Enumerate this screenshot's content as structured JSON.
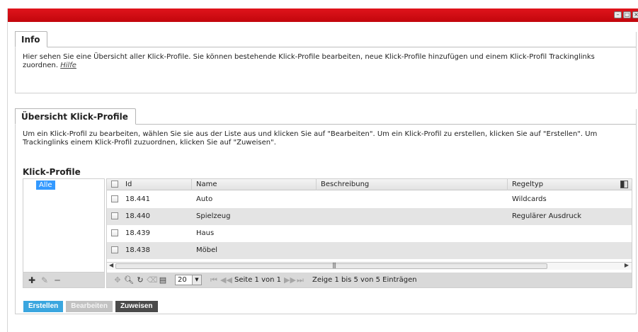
{
  "window": {
    "controls": [
      "–",
      "□",
      "×"
    ]
  },
  "info": {
    "tab": "Info",
    "text": "Hier sehen Sie eine Übersicht aller Klick-Profile. Sie können bestehende Klick-Profile bearbeiten, neue Klick-Profile hinzufügen und einem Klick-Profil Trackinglinks zuordnen.",
    "help_link": "Hilfe"
  },
  "overview": {
    "tab": "Übersicht Klick-Profile",
    "text": "Um ein Klick-Profil zu bearbeiten, wählen Sie sie aus der Liste aus und klicken Sie auf \"Bearbeiten\". Um ein Klick-Profil zu erstellen, klicken Sie auf \"Erstellen\". Um Trackinglinks einem Klick-Profil zuzuordnen, klicken Sie auf \"Zuweisen\".",
    "section_title": "Klick-Profile",
    "tree": {
      "selected": "Alle"
    },
    "grid": {
      "columns": [
        "Id",
        "Name",
        "Beschreibung",
        "Regeltyp"
      ],
      "rows": [
        {
          "id": "18.441",
          "name": "Auto",
          "beschreibung": "",
          "regeltyp": "Wildcards"
        },
        {
          "id": "18.440",
          "name": "Spielzeug",
          "beschreibung": "",
          "regeltyp": "Regulärer Ausdruck"
        },
        {
          "id": "18.439",
          "name": "Haus",
          "beschreibung": "",
          "regeltyp": ""
        },
        {
          "id": "18.438",
          "name": "Möbel",
          "beschreibung": "",
          "regeltyp": ""
        }
      ]
    },
    "pager": {
      "page_size": "20",
      "page_text": "Seite 1 von 1",
      "records_text": "Zeige 1 bis 5 von 5 Einträgen"
    }
  },
  "buttons": {
    "create": "Erstellen",
    "edit": "Bearbeiten",
    "assign": "Zuweisen"
  },
  "colors": {
    "titlebar": "#d00a12",
    "create_button": "#3aa6df",
    "assign_button": "#4a4a4a",
    "selection": "#3399ff"
  }
}
